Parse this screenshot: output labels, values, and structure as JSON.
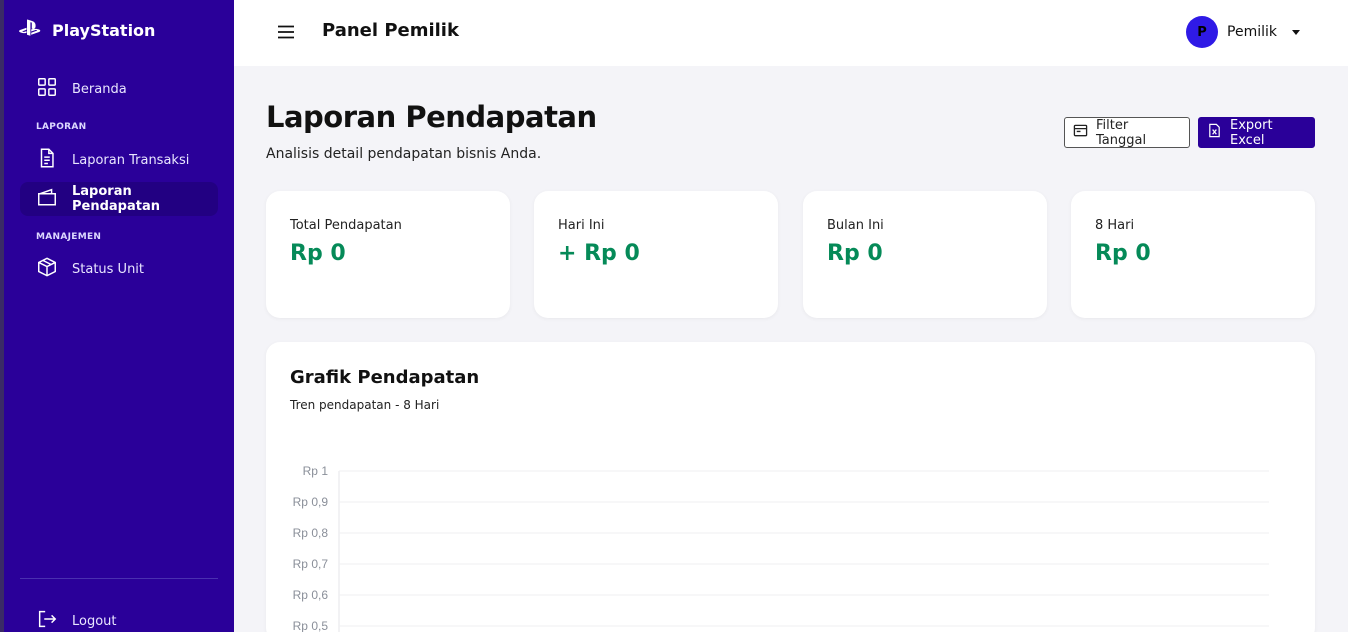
{
  "brand": {
    "name": "PlayStation"
  },
  "sidebar": {
    "items": [
      {
        "label": "Beranda",
        "icon": "grid-icon"
      },
      {
        "label": "Laporan Transaksi",
        "icon": "document-icon"
      },
      {
        "label": "Laporan Pendapatan",
        "icon": "wallet-icon",
        "active": true
      },
      {
        "label": "Status Unit",
        "icon": "box-icon"
      }
    ],
    "sections": {
      "laporan": "LAPORAN",
      "manajemen": "MANAJEMEN"
    },
    "logout": "Logout"
  },
  "topbar": {
    "title": "Panel Pemilik",
    "user": {
      "initial": "P",
      "name": "Pemilik"
    }
  },
  "page": {
    "title": "Laporan Pendapatan",
    "subtitle": "Analisis detail pendapatan bisnis Anda.",
    "filter_label": "Filter Tanggal",
    "export_label": "Export Excel"
  },
  "stats": [
    {
      "label": "Total Pendapatan",
      "value": "Rp 0"
    },
    {
      "label": "Hari Ini",
      "value": "+ Rp 0"
    },
    {
      "label": "Bulan Ini",
      "value": "Rp 0"
    },
    {
      "label": "8 Hari",
      "value": "Rp 0"
    }
  ],
  "chart": {
    "title": "Grafik Pendapatan",
    "subtitle": "Tren pendapatan - 8 Hari"
  },
  "chart_data": {
    "type": "line",
    "title": "Grafik Pendapatan",
    "subtitle": "Tren pendapatan - 8 Hari",
    "yticks": [
      "Rp 1",
      "Rp 0,9",
      "Rp 0,8",
      "Rp 0,7",
      "Rp 0,6",
      "Rp 0,5"
    ],
    "ylim": [
      0,
      1
    ],
    "grid": true,
    "series": []
  },
  "colors": {
    "sidebar": "#2a0099",
    "accent": "#2a0099",
    "positive": "#058a58",
    "avatar": "#2f1ae6"
  }
}
